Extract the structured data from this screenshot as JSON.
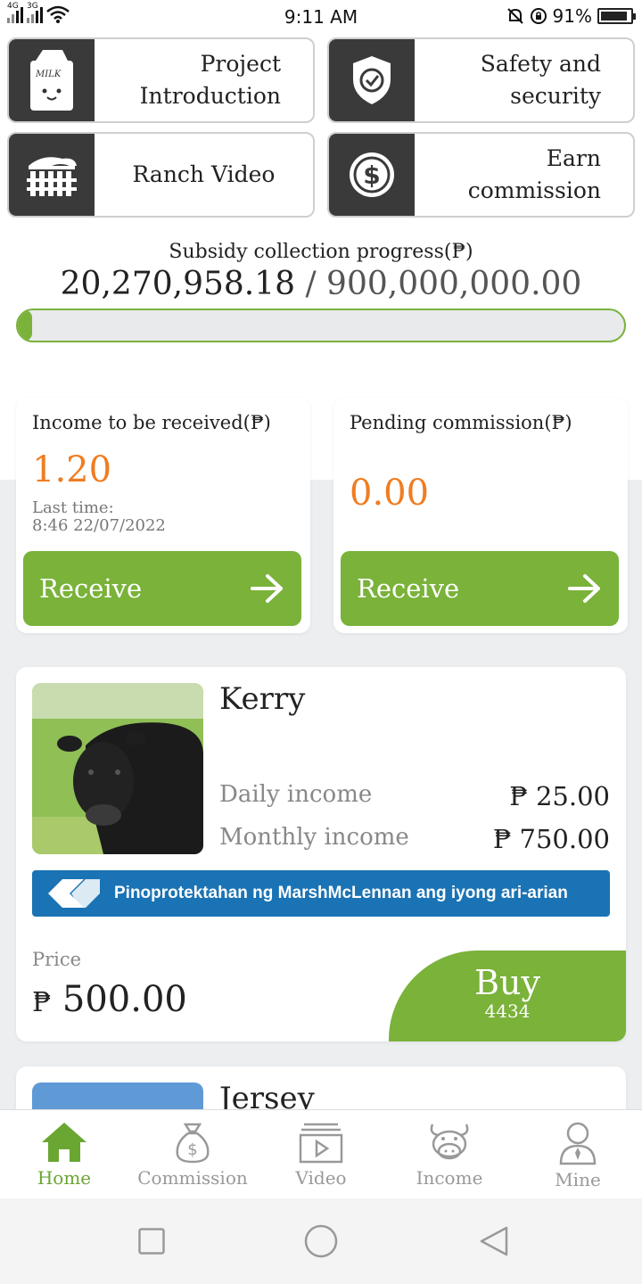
{
  "status_bar": {
    "time": "9:11 AM",
    "battery": "91%",
    "signal1": "4G",
    "signal2": "3G"
  },
  "tiles": [
    {
      "label": "Project Introduction",
      "icon": "milk-carton-icon"
    },
    {
      "label": "Safety and security",
      "icon": "shield-check-icon"
    },
    {
      "label": "Ranch Video",
      "icon": "ranch-fence-icon"
    },
    {
      "label": "Earn commission",
      "icon": "dollar-coin-icon"
    }
  ],
  "progress": {
    "title": "Subsidy collection progress(₱)",
    "collected": "20,270,958.18",
    "separator": " / ",
    "target": "900,000,000.00",
    "fraction": 0.0225
  },
  "income_card": {
    "title": "Income to be received(₱)",
    "value": "1.20",
    "last_time_label": "Last time:",
    "last_time": "8:46 22/07/2022",
    "button": "Receive"
  },
  "commission_card": {
    "title": "Pending commission(₱)",
    "value": "0.00",
    "button": "Receive"
  },
  "products": [
    {
      "name": "Kerry",
      "daily_label": "Daily income",
      "daily_value": "₱ 25.00",
      "monthly_label": "Monthly income",
      "monthly_value": "₱ 750.00",
      "insurance": "Pinoprotektahan ng MarshMcLennan ang iyong ari-arian",
      "price_label": "Price",
      "price_symbol": "₱",
      "price": "500.00",
      "buy_label": "Buy",
      "buy_count": "4434"
    },
    {
      "name": "Jersey"
    }
  ],
  "tabbar": [
    {
      "label": "Home",
      "icon": "home-icon",
      "active": true
    },
    {
      "label": "Commission",
      "icon": "money-bag-icon",
      "active": false
    },
    {
      "label": "Video",
      "icon": "video-play-icon",
      "active": false
    },
    {
      "label": "Income",
      "icon": "cow-face-icon",
      "active": false
    },
    {
      "label": "Mine",
      "icon": "person-icon",
      "active": false
    }
  ],
  "colors": {
    "accent_green": "#7ab23a",
    "orange": "#ef7d22",
    "insurance_blue": "#1a73b4",
    "tile_dark": "#3a3a3a"
  }
}
